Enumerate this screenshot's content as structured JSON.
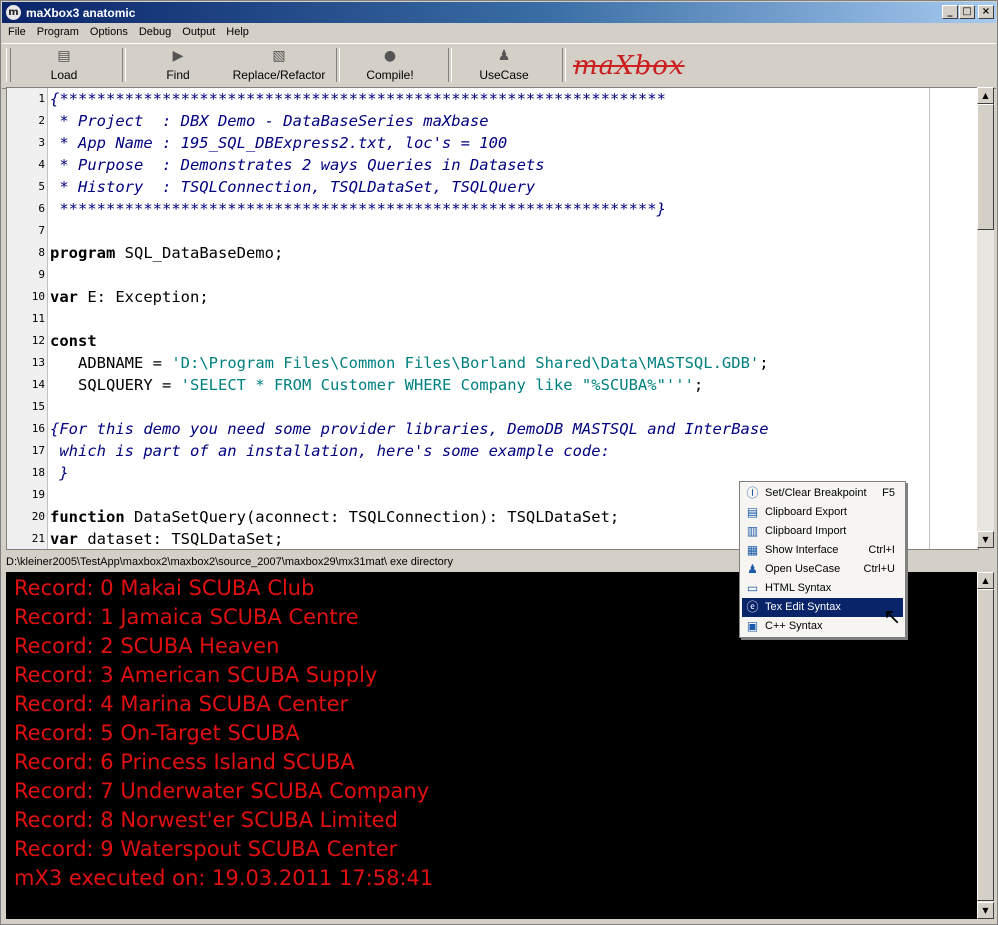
{
  "window": {
    "title": "maXbox3 anatomic",
    "icon": "app-icon",
    "minimize": "_",
    "maximize": "□",
    "close": "×"
  },
  "menu": [
    "File",
    "Program",
    "Options",
    "Debug",
    "Output",
    "Help"
  ],
  "toolbar": {
    "load": "Load",
    "find": "Find",
    "replace": "Replace/Refactor",
    "compile": "Compile!",
    "usecase": "UseCase",
    "logo": "maXbox"
  },
  "editor": {
    "lines": [
      {
        "n": "1",
        "t": "{*****************************************************************",
        "k": "cm"
      },
      {
        "n": "2",
        "t": " * Project  : DBX Demo - DataBaseSeries maXbase",
        "k": "cm"
      },
      {
        "n": "3",
        "t": " * App Name : 195_SQL_DBExpress2.txt, loc's = 100",
        "k": "cm"
      },
      {
        "n": "4",
        "t": " * Purpose  : Demonstrates 2 ways Queries in Datasets",
        "k": "cm"
      },
      {
        "n": "5",
        "t": " * History  : TSQLConnection, TSQLDataSet, TSQLQuery",
        "k": "cm"
      },
      {
        "n": "6",
        "t": " ****************************************************************}",
        "k": "cm"
      },
      {
        "n": "7",
        "t": "",
        "k": "tx"
      },
      {
        "n": "8",
        "t": "",
        "k": "tx",
        "kw": "program",
        "rest": " SQL_DataBaseDemo;"
      },
      {
        "n": "9",
        "t": "",
        "k": "tx"
      },
      {
        "n": "10",
        "t": "",
        "k": "tx",
        "kw": "var",
        "rest": " E: Exception;"
      },
      {
        "n": "11",
        "t": "",
        "k": "tx"
      },
      {
        "n": "12",
        "t": "",
        "k": "tx",
        "kw": "const",
        "rest": ""
      },
      {
        "n": "13",
        "t": "",
        "k": "tx",
        "pre": "   ADBNAME = ",
        "str": "'D:\\Program Files\\Common Files\\Borland Shared\\Data\\MASTSQL.GDB'",
        "post": ";"
      },
      {
        "n": "14",
        "t": "",
        "k": "tx",
        "pre": "   SQLQUERY = ",
        "str": "'SELECT * FROM Customer WHERE Company like \"%SCUBA%\"'''",
        "post": ";"
      },
      {
        "n": "15",
        "t": "",
        "k": "tx"
      },
      {
        "n": "16",
        "t": "{For this demo you need some provider libraries, DemoDB MASTSQL and InterBase",
        "k": "cm"
      },
      {
        "n": "17",
        "t": " which is part of an installation, here's some example code:",
        "k": "cm"
      },
      {
        "n": "18",
        "t": " }",
        "k": "cm"
      },
      {
        "n": "19",
        "t": "",
        "k": "tx"
      },
      {
        "n": "20",
        "t": "",
        "k": "tx",
        "kw": "function",
        "rest": " DataSetQuery(aconnect: TSQLConnection): TSQLDataSet;"
      },
      {
        "n": "21",
        "t": "",
        "k": "tx",
        "kw": "var",
        "rest": " dataset: TSQLDataSet;"
      }
    ]
  },
  "status": "D:\\kleiner2005\\TestApp\\maxbox2\\maxbox2\\source_2007\\maxbox29\\mx31mat\\ exe directory",
  "output": [
    "Record: 0 Makai SCUBA Club",
    "Record: 1 Jamaica SCUBA Centre",
    "Record: 2 SCUBA Heaven",
    "Record: 3 American SCUBA Supply",
    "Record: 4 Marina SCUBA Center",
    "Record: 5 On-Target SCUBA",
    "Record: 6 Princess Island SCUBA",
    "Record: 7 Underwater SCUBA Company",
    "Record: 8 Norwest'er SCUBA Limited",
    "Record: 9 Waterspout SCUBA Center",
    "mX3 executed on: 19.03.2011 17:58:41"
  ],
  "context_menu": [
    {
      "label": "Set/Clear Breakpoint",
      "key": "F5",
      "icon": "breakpoint-icon"
    },
    {
      "label": "Clipboard Export",
      "key": "",
      "icon": "clipboard-export-icon"
    },
    {
      "label": "Clipboard Import",
      "key": "",
      "icon": "clipboard-import-icon"
    },
    {
      "label": "Show Interface",
      "key": "Ctrl+I",
      "icon": "interface-icon"
    },
    {
      "label": "Open UseCase",
      "key": "Ctrl+U",
      "icon": "usecase-icon"
    },
    {
      "label": "HTML Syntax",
      "key": "",
      "icon": "folder-icon"
    },
    {
      "label": "Tex Edit Syntax",
      "key": "",
      "icon": "tex-icon"
    },
    {
      "label": "C++ Syntax",
      "key": "",
      "icon": "cpp-icon"
    }
  ]
}
